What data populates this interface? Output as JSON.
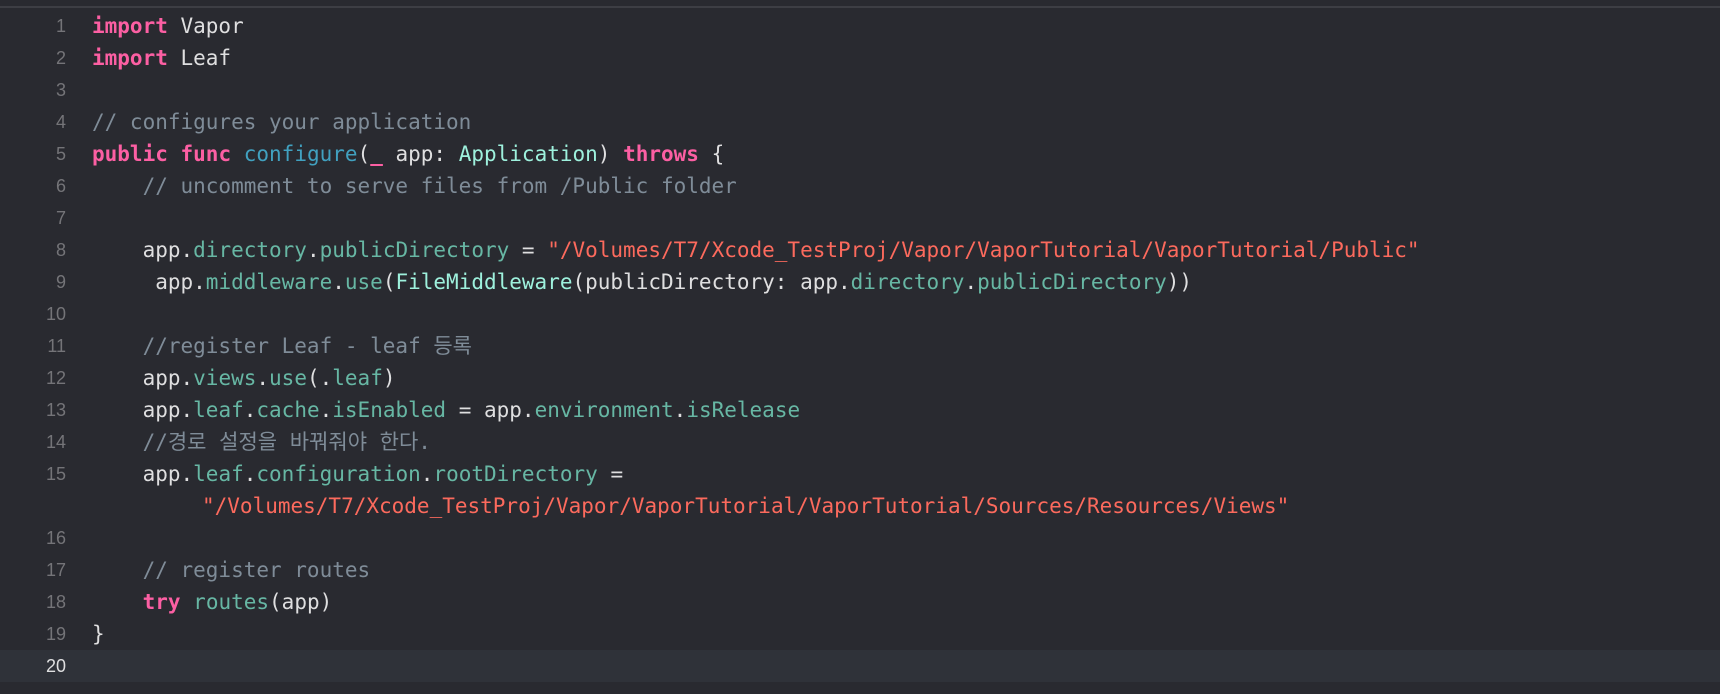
{
  "editor": {
    "current_line": 20,
    "lines": [
      {
        "number": "1",
        "tokens": [
          "import",
          " Vapor"
        ]
      },
      {
        "number": "2",
        "tokens": [
          "import",
          " Leaf"
        ]
      },
      {
        "number": "3",
        "tokens": []
      },
      {
        "number": "4",
        "tokens": [
          "// configures your application"
        ]
      },
      {
        "number": "5",
        "tokens": [
          "public",
          " ",
          "func",
          " ",
          "configure",
          "(",
          "_",
          " app: ",
          "Application",
          ") ",
          "throws",
          " {"
        ]
      },
      {
        "number": "6",
        "tokens": [
          "    // uncomment to serve files from /Public folder"
        ]
      },
      {
        "number": "7",
        "tokens": []
      },
      {
        "number": "8",
        "tokens": [
          "    app.",
          "directory",
          ".",
          "publicDirectory",
          " = ",
          "\"/Volumes/T7/Xcode_TestProj/Vapor/VaporTutorial/VaporTutorial/Public\""
        ]
      },
      {
        "number": "9",
        "tokens": [
          "     app.",
          "middleware",
          ".",
          "use",
          "(",
          "FileMiddleware",
          "(publicDirectory: app.",
          "directory",
          ".",
          "publicDirectory",
          "))"
        ]
      },
      {
        "number": "10",
        "tokens": []
      },
      {
        "number": "11",
        "tokens": [
          "    //register Leaf - leaf 등록"
        ]
      },
      {
        "number": "12",
        "tokens": [
          "    app.",
          "views",
          ".",
          "use",
          "(.",
          "leaf",
          ")"
        ]
      },
      {
        "number": "13",
        "tokens": [
          "    app.",
          "leaf",
          ".",
          "cache",
          ".",
          "isEnabled",
          " = app.",
          "environment",
          ".",
          "isRelease"
        ]
      },
      {
        "number": "14",
        "tokens": [
          "    //경로 설정을 바꿔줘야 한다."
        ]
      },
      {
        "number": "15",
        "tokens": [
          "    app.",
          "leaf",
          ".",
          "configuration",
          ".",
          "rootDirectory",
          " ="
        ],
        "continuation": "\"/Volumes/T7/Xcode_TestProj/Vapor/VaporTutorial/VaporTutorial/Sources/Resources/Views\""
      },
      {
        "number": "16",
        "tokens": []
      },
      {
        "number": "17",
        "tokens": [
          "    // register routes"
        ]
      },
      {
        "number": "18",
        "tokens": [
          "    ",
          "try",
          " ",
          "routes",
          "(app)"
        ]
      },
      {
        "number": "19",
        "tokens": [
          "}"
        ]
      },
      {
        "number": "20",
        "tokens": []
      }
    ]
  },
  "colors": {
    "background": "#292a30",
    "current_line": "#2f3239",
    "keyword": "#fc5fa3",
    "string": "#fc6a5d",
    "comment": "#7f8c98",
    "type": "#9ef1dd",
    "property": "#67b7a4",
    "function_declaration": "#41a1c0",
    "plain_text": "#dfdfe0",
    "line_number": "#747478"
  }
}
